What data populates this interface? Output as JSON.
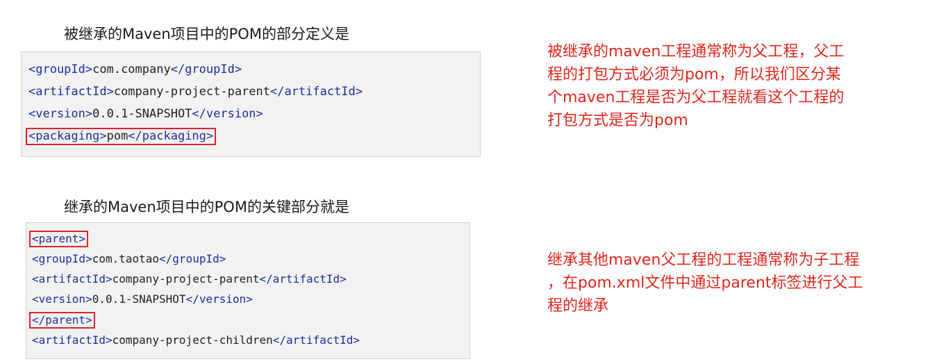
{
  "section1": {
    "heading": "被继承的Maven项目中的POM的部分定义是",
    "code": [
      {
        "open": "<groupId>",
        "value": "com.company",
        "close": "</groupId>"
      },
      {
        "open": "<artifactId>",
        "value": "company-project-parent",
        "close": "</artifactId>"
      },
      {
        "open": "<version>",
        "value": "0.0.1-SNAPSHOT",
        "close": "</version>"
      },
      {
        "open": "<packaging>",
        "value": "pom",
        "close": "</packaging>"
      }
    ],
    "note_lines": [
      "被继承的maven工程通常称为父工程，父工",
      "程的打包方式必须为pom，所以我们区分某",
      "个maven工程是否为父工程就看这个工程的",
      "打包方式是否为pom"
    ]
  },
  "section2": {
    "heading": "继承的Maven项目中的POM的关键部分就是",
    "code": [
      {
        "tag": "<parent>"
      },
      {
        "open": "<groupId>",
        "value": "com.taotao",
        "close": "</groupId>"
      },
      {
        "open": "<artifactId>",
        "value": "company-project-parent",
        "close": "</artifactId>"
      },
      {
        "open": "<version>",
        "value": "0.0.1-SNAPSHOT",
        "close": "</version>"
      },
      {
        "tag": "</parent>"
      },
      {
        "open": "<artifactId>",
        "value": "company-project-children",
        "close": "</artifactId>"
      }
    ],
    "note_lines": [
      "继承其他maven父工程的工程通常称为子工程",
      "，在pom.xml文件中通过parent标签进行父工",
      "程的继承"
    ]
  },
  "colors": {
    "tag": "#1c2f9e",
    "highlight_box": "#d9232a",
    "note_text": "#e3261d",
    "code_bg": "#f2f2f2"
  }
}
